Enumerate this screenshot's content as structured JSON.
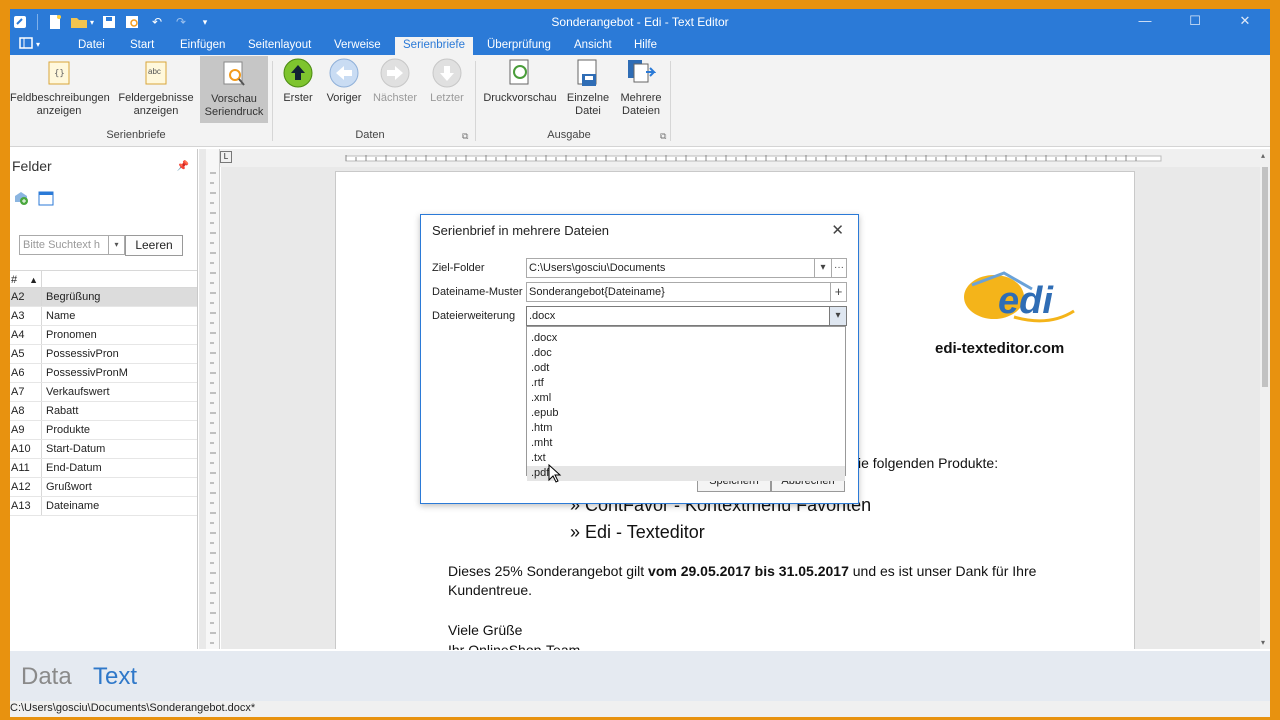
{
  "window": {
    "title": "Sonderangebot - Edi - Text Editor"
  },
  "menu": {
    "tabs": [
      "Datei",
      "Start",
      "Einfügen",
      "Seitenlayout",
      "Verweise",
      "Serienbriefe",
      "Überprüfung",
      "Ansicht",
      "Hilfe"
    ],
    "active": "Serienbriefe"
  },
  "ribbon": {
    "feldbeschreibungen": "Feldbeschreibungen anzeigen",
    "feldergebnisse": "Feldergebnisse anzeigen",
    "vorschau": "Vorschau Seriendruck",
    "erster": "Erster",
    "voriger": "Voriger",
    "naechster": "Nächster",
    "letzter": "Letzter",
    "druckvorschau": "Druckvorschau",
    "einzelne": "Einzelne Datei",
    "mehrere": "Mehrere Dateien",
    "group_serienbriefe": "Serienbriefe",
    "group_daten": "Daten",
    "group_ausgabe": "Ausgabe"
  },
  "fields_panel": {
    "title": "Felder",
    "search_placeholder": "Bitte Suchtext h",
    "clear_label": "Leeren",
    "col_hash": "#",
    "rows": [
      {
        "id": "A2",
        "name": "Begrüßung"
      },
      {
        "id": "A3",
        "name": "Name"
      },
      {
        "id": "A4",
        "name": "Pronomen"
      },
      {
        "id": "A5",
        "name": "PossessivPron"
      },
      {
        "id": "A6",
        "name": "PossessivPronM"
      },
      {
        "id": "A7",
        "name": "Verkaufswert"
      },
      {
        "id": "A8",
        "name": "Rabatt"
      },
      {
        "id": "A9",
        "name": "Produkte"
      },
      {
        "id": "A10",
        "name": "Start-Datum"
      },
      {
        "id": "A11",
        "name": "End-Datum"
      },
      {
        "id": "A12",
        "name": "Grußwort"
      },
      {
        "id": "A13",
        "name": "Dateiname"
      }
    ]
  },
  "document": {
    "logo_url": "edi-texteditor.com",
    "line_products_tail": "ie folgenden Produkte:",
    "bullet1": "» ContFavor - Kontextmenü Favoriten",
    "bullet2": "» Edi - Texteditor",
    "para_a": "Dieses 25% Sonderangebot gilt ",
    "para_bold": "vom 29.05.2017 bis 31.05.2017",
    "para_b": " und es ist unser Dank für Ihre",
    "para_c": "Kundentreue.",
    "closing1": "Viele Grüße",
    "closing2": "Ihr OnlineShop-Team"
  },
  "dialog": {
    "title": "Serienbrief in mehrere Dateien",
    "ziel_label": "Ziel-Folder",
    "ziel_value": "C:\\Users\\gosciu\\Documents",
    "muster_label": "Dateiname-Muster",
    "muster_value": "Sonderangebot{Dateiname}",
    "ext_label": "Dateierweiterung",
    "ext_value": ".docx",
    "ext_options": [
      ".docx",
      ".doc",
      ".odt",
      ".rtf",
      ".xml",
      ".epub",
      ".htm",
      ".mht",
      ".txt",
      ".pdf"
    ],
    "hover_option": ".pdf",
    "save_label": "Speichern",
    "cancel_label": "Abbrechen"
  },
  "bottom": {
    "data_label": "Data",
    "text_label": "Text"
  },
  "status": {
    "path": "C:\\Users\\gosciu\\Documents\\Sonderangebot.docx*"
  }
}
